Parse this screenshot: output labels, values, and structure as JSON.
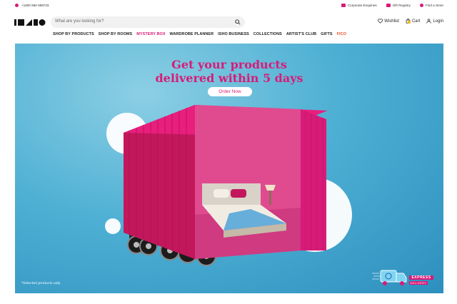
{
  "topbar": {
    "phone": "+1800 960 688733",
    "links": [
      "Corporate Enquiries",
      "Gift Registry",
      "Find a Store"
    ]
  },
  "header": {
    "logo_text": "IKHO",
    "search_placeholder": "What are you looking for?",
    "actions": {
      "wishlist": "Wishlist",
      "cart": "Cart",
      "login": "Login"
    }
  },
  "nav": {
    "items": [
      "SHOP BY PRODUCTS",
      "SHOP BY ROOMS",
      "MYSTERY BOX",
      "WARDROBE PLANNER",
      "ISHO BUSINESS",
      "COLLECTIONS",
      "ARTIST'S CLUB",
      "GIFTS",
      "FICO"
    ]
  },
  "banner": {
    "headline_line1": "Get your products",
    "headline_line2": "delivered within 5 days",
    "cta": "Order Now",
    "footnote": "*Selected products only",
    "badge_line1": "EXPRESS",
    "badge_line2": "DELIVERY"
  },
  "colors": {
    "brand": "#d81b78",
    "sky": "#4fb0d4"
  }
}
